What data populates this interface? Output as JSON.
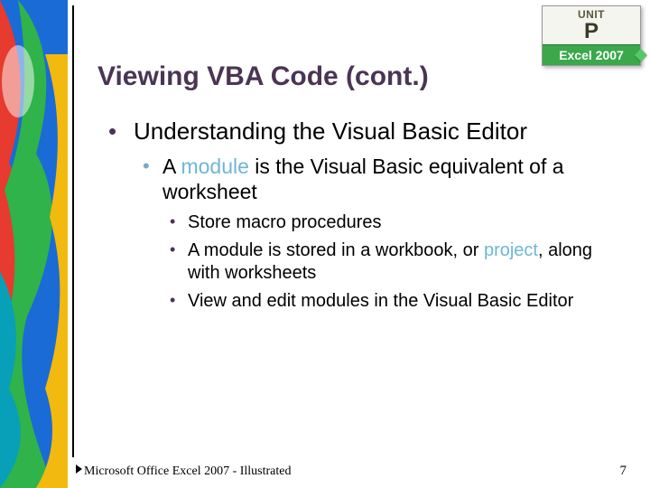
{
  "badge": {
    "unit": "UNIT",
    "letter": "P",
    "product": "Excel 2007"
  },
  "title": "Viewing VBA Code (cont.)",
  "bullets": {
    "l1": "Understanding the Visual Basic Editor",
    "l2_pre": "A ",
    "l2_kw": "module",
    "l2_post": " is the Visual Basic equivalent of a worksheet",
    "l3a": "Store macro procedures",
    "l3b_pre": "A module is stored in a workbook, or ",
    "l3b_kw": "project",
    "l3b_post": ", along with worksheets",
    "l3c": "View and edit modules in the Visual Basic Editor"
  },
  "footer": {
    "left": "Microsoft Office Excel 2007 - Illustrated",
    "page": "7"
  }
}
